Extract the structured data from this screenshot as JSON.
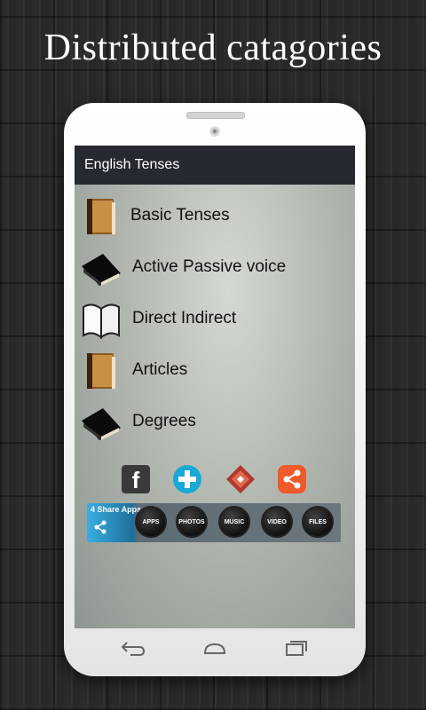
{
  "headline": "Distributed catagories",
  "app": {
    "title": "English Tenses"
  },
  "menu": [
    {
      "label": "Basic Tenses",
      "icon": "brown-book-icon"
    },
    {
      "label": "Active Passive voice",
      "icon": "black-book-icon"
    },
    {
      "label": "Direct Indirect",
      "icon": "open-book-icon"
    },
    {
      "label": "Articles",
      "icon": "brown-book-icon"
    },
    {
      "label": "Degrees",
      "icon": "black-book-icon"
    }
  ],
  "social": [
    {
      "name": "facebook",
      "glyph": "f",
      "color": "#3a3a3a"
    },
    {
      "name": "add",
      "glyph": "+",
      "color": "#1aa8d6"
    },
    {
      "name": "app",
      "glyph": "",
      "color": "#b03a2e"
    },
    {
      "name": "share",
      "glyph": "",
      "color": "#ef5a2a"
    }
  ],
  "ad": {
    "title": "4 Share Apps",
    "chips": [
      "APPS",
      "PHOTOS",
      "MUSIC",
      "VIDEO",
      "FILES"
    ]
  }
}
